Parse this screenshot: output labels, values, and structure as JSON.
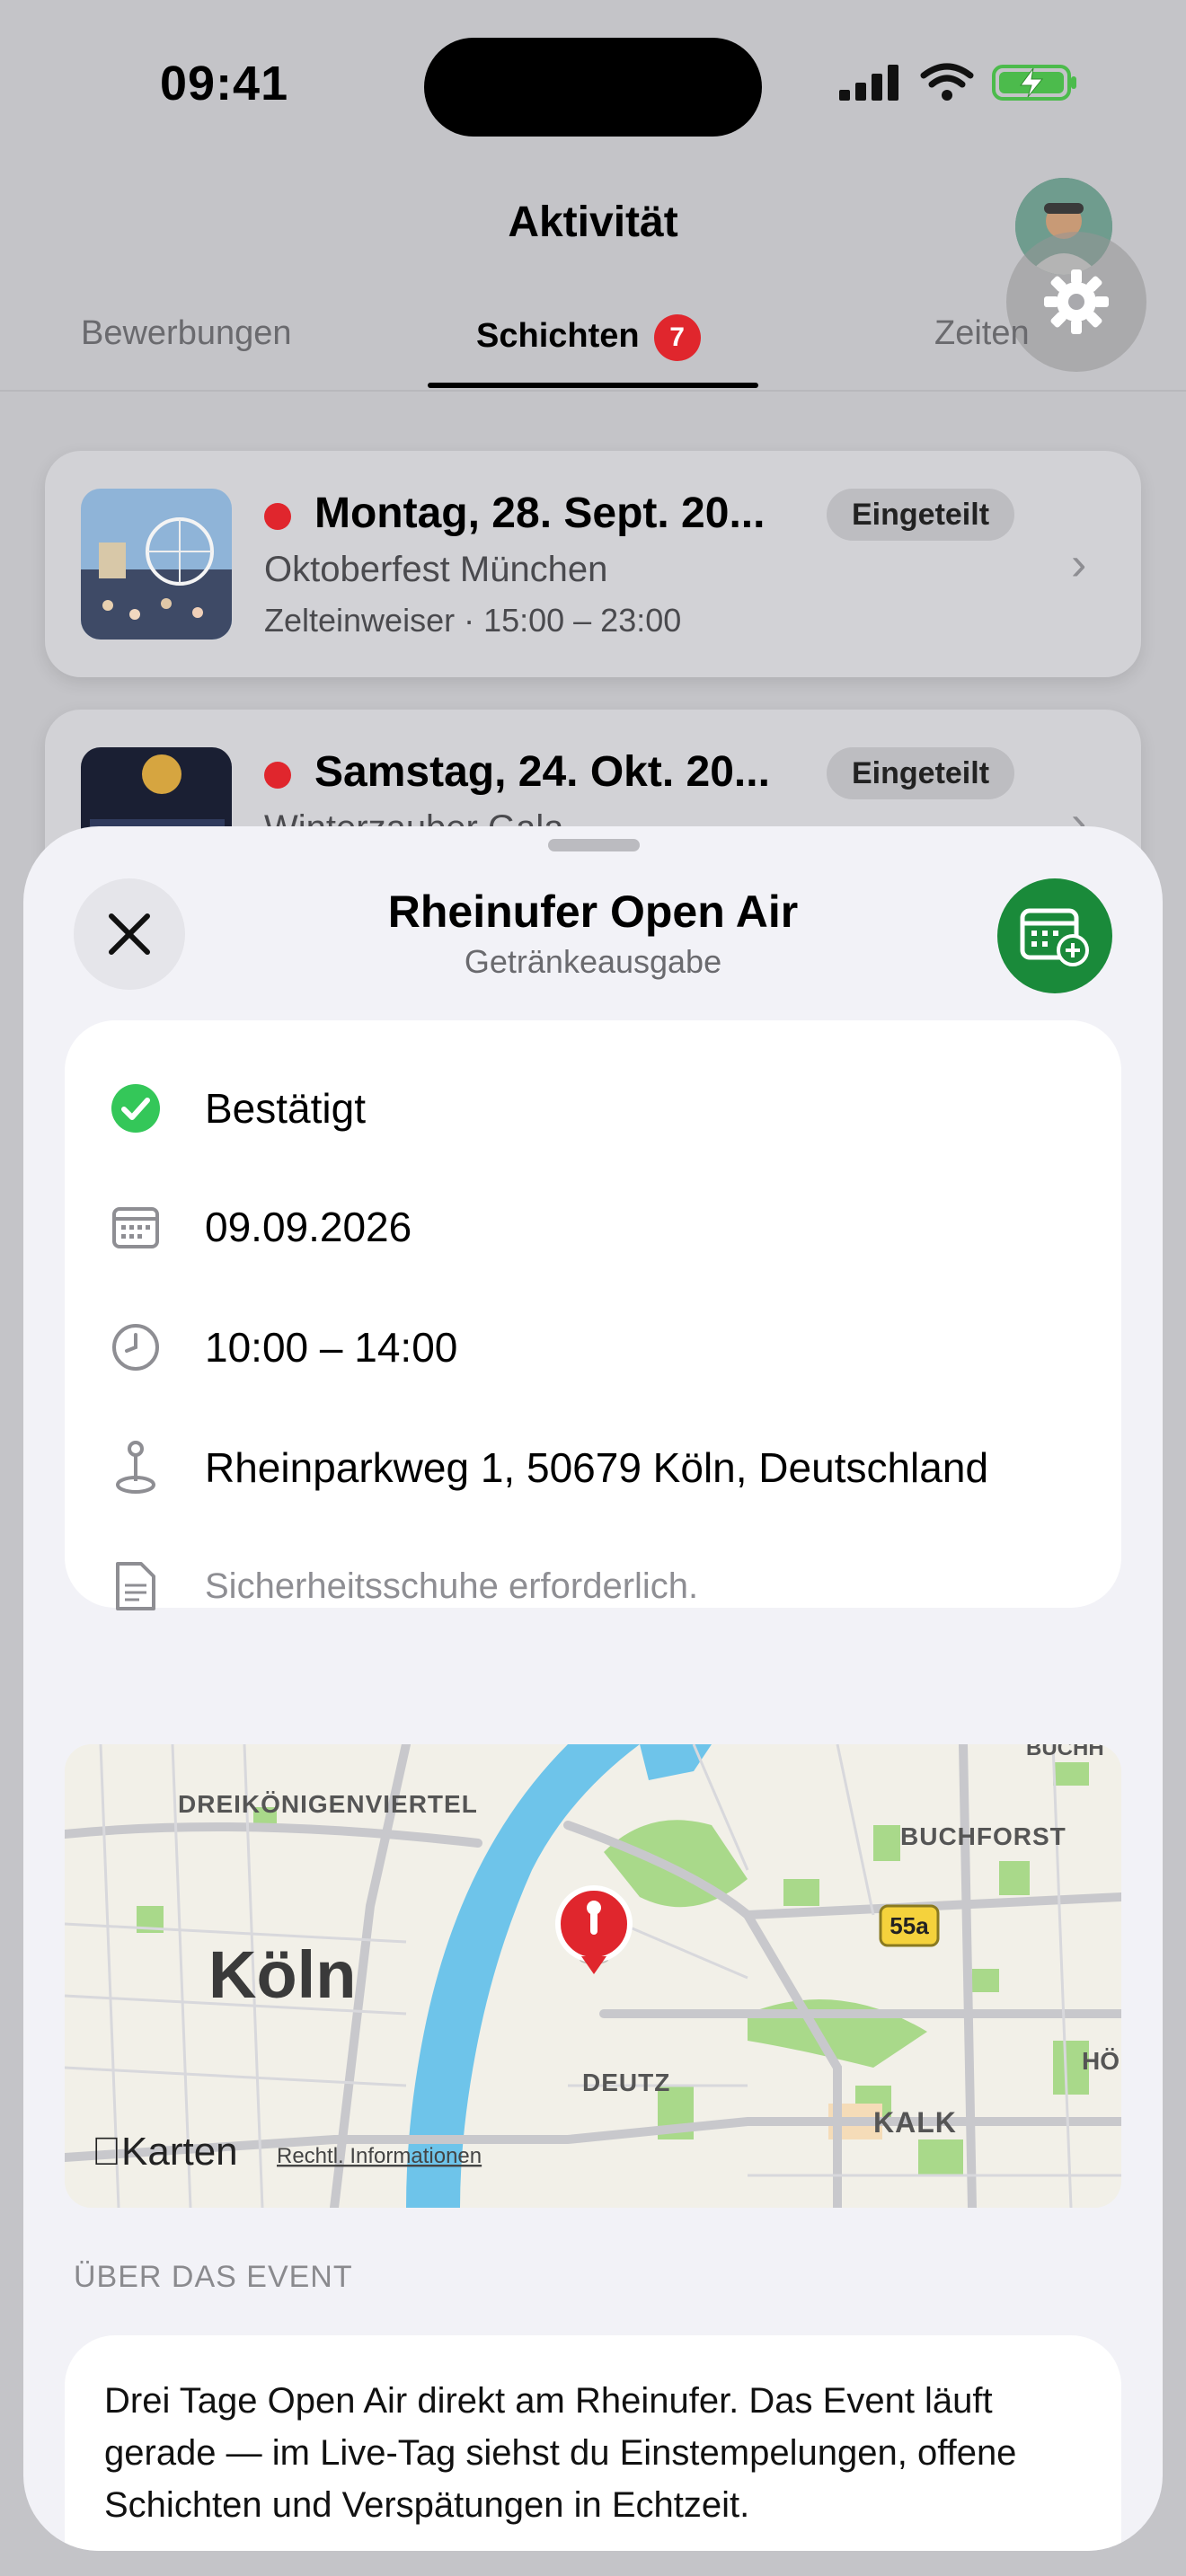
{
  "status_bar": {
    "time": "09:41"
  },
  "nav": {
    "title": "Aktivität"
  },
  "tabs": [
    {
      "label": "Bewerbungen",
      "active": false
    },
    {
      "label": "Schichten",
      "active": true,
      "badge": "7"
    },
    {
      "label": "Zeiten",
      "active": false
    }
  ],
  "shifts": [
    {
      "date": "Montag, 28. Sept. 20...",
      "status": "Eingeteilt",
      "event": "Oktoberfest München",
      "meta": "Zelteinweiser · 15:00 – 23:00"
    },
    {
      "date": "Samstag, 24. Okt. 20...",
      "status": "Eingeteilt",
      "event": "Winterzauber Gala"
    }
  ],
  "sheet": {
    "title": "Rheinufer Open Air",
    "subtitle": "Getränkeausgabe",
    "close_icon": "close-icon",
    "calendar_icon": "calendar-add-icon",
    "details": {
      "status": "Bestätigt",
      "date": "09.09.2026",
      "time": "10:00 – 14:00",
      "address": "Rheinparkweg 1, 50679 Köln, Deutschland",
      "note": "Sicherheitsschuhe erforderlich."
    },
    "map": {
      "city": "Köln",
      "labels": [
        "DREIKÖNIGENVIERTEL",
        "BUCHFORST",
        "DEUTZ",
        "KALK",
        "HÖ",
        "BUCHH"
      ],
      "road_shield": "55a",
      "brand": "Karten",
      "legal": "Rechtl. Informationen"
    },
    "about_label": "ÜBER DAS EVENT",
    "about_text": "Drei Tage Open Air direkt am Rheinufer. Das Event läuft gerade — im Live-Tag siehst du Einstempelungen, offene Schichten und Verspätungen in Echtzeit."
  },
  "colors": {
    "accent_green": "#1a8a3a",
    "confirm_green": "#34c759",
    "badge_red": "#e0262d",
    "pin_red": "#e0262d"
  }
}
